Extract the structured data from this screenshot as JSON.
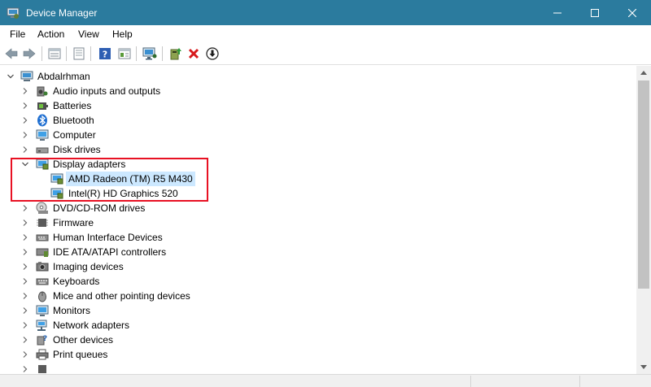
{
  "window": {
    "title": "Device Manager"
  },
  "menu": [
    "File",
    "Action",
    "View",
    "Help"
  ],
  "toolbar": {
    "buttons": [
      "back-arrow-icon",
      "forward-arrow-icon",
      "properties-grid-icon",
      "properties-sheet-icon",
      "help-icon",
      "show-hidden-icon",
      "monitor-scan-icon",
      "update-driver-icon",
      "uninstall-x-icon",
      "disable-device-icon"
    ]
  },
  "tree": {
    "root": "Abdalrhman",
    "categories": [
      "Audio inputs and outputs",
      "Batteries",
      "Bluetooth",
      "Computer",
      "Disk drives",
      "Display adapters",
      "DVD/CD-ROM drives",
      "Firmware",
      "Human Interface Devices",
      "IDE ATA/ATAPI controllers",
      "Imaging devices",
      "Keyboards",
      "Mice and other pointing devices",
      "Monitors",
      "Network adapters",
      "Other devices",
      "Print queues"
    ],
    "display_adapters": [
      "AMD Radeon (TM) R5 M430",
      "Intel(R) HD Graphics 520"
    ],
    "selected": "AMD Radeon (TM) R5 M430"
  },
  "colors": {
    "titlebar": "#2b7b9e",
    "selection": "#cce8ff",
    "highlight_box": "#e81123"
  }
}
